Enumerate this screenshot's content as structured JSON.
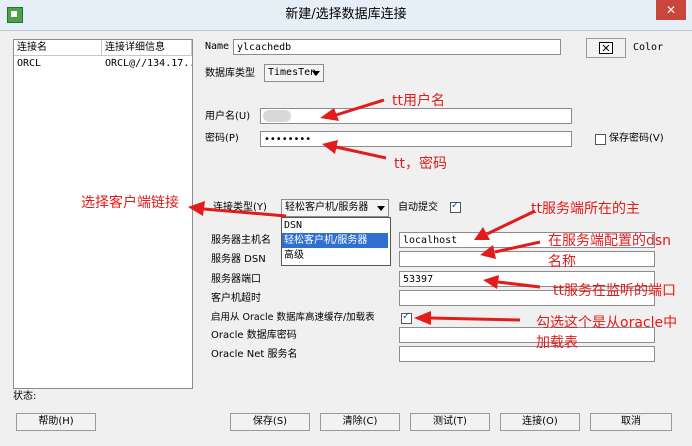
{
  "window": {
    "title": "新建/选择数据库连接",
    "close_label": "✕"
  },
  "connection_list": {
    "headers": [
      "连接名",
      "连接详细信息"
    ],
    "rows": [
      {
        "name": "ORCL",
        "details": "ORCL@//134.17..."
      }
    ]
  },
  "form": {
    "name_label": "Name",
    "name_value": "ylcachedb",
    "color_label": "Color",
    "dbtype_label": "数据库类型",
    "dbtype_value": "TimesTen",
    "username_label": "用户名(U)",
    "username_value": "",
    "password_label": "密码(P)",
    "password_value": "••••••••",
    "save_password_label": "保存密码(V)",
    "save_password_checked": false,
    "conn_type_label": "连接类型(Y)",
    "conn_type_value": "轻松客户机/服务器",
    "autocommit_label": "自动提交",
    "autocommit_checked": true,
    "conn_type_options": [
      "DSN",
      "轻松客户机/服务器",
      "高级"
    ],
    "server_host_label": "服务器主机名",
    "server_host_value": "localhost",
    "server_dsn_label": "服务器 DSN",
    "server_dsn_value": "",
    "server_port_label": "服务器端口",
    "server_port_value": "53397",
    "client_timeout_label": "客户机超时",
    "client_timeout_value": "",
    "oracle_cache_label": "启用从 Oracle 数据库高速缓存/加载表",
    "oracle_cache_checked": true,
    "oracle_password_label": "Oracle 数据库密码",
    "oracle_password_value": "",
    "oracle_net_label": "Oracle Net 服务名",
    "oracle_net_value": ""
  },
  "status_label": "状态:",
  "buttons": {
    "help": "帮助(H)",
    "save": "保存(S)",
    "clear": "清除(C)",
    "test": "测试(T)",
    "connect": "连接(O)",
    "cancel": "取消"
  },
  "annotations": {
    "tt_user": "tt用户名",
    "tt_password": "tt，密码",
    "client_link": "选择客户端链接",
    "server_host": "tt服务端所在的主",
    "dsn_line1": "在服务端配置的dsn",
    "dsn_line2": "名称",
    "port": "tt服务在监听的端口",
    "oracle_line1": "勾选这个是从oracle中",
    "oracle_line2": "加载表"
  },
  "colors": {
    "annotation": "#e21b1b",
    "selection": "#2f6fd0"
  }
}
